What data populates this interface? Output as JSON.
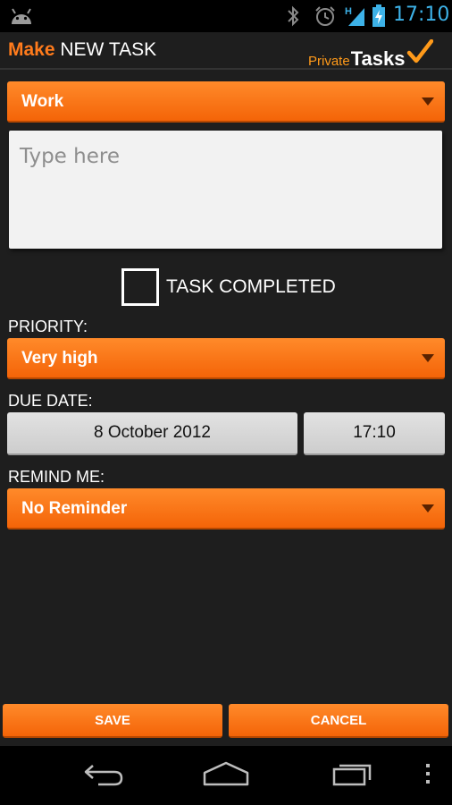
{
  "status_bar": {
    "time": "17:10",
    "network_type": "H",
    "icons": [
      "android-icon",
      "bluetooth-icon",
      "alarm-icon",
      "signal-icon",
      "battery-charging-icon"
    ]
  },
  "header": {
    "title_accent": "Make",
    "title_rest": "NEW TASK",
    "logo_small": "Private",
    "logo_big": "Tasks"
  },
  "form": {
    "category": {
      "value": "Work"
    },
    "description": {
      "value": "",
      "placeholder": "Type here"
    },
    "completed": {
      "label": "TASK COMPLETED",
      "checked": false
    },
    "priority": {
      "label": "PRIORITY:",
      "value": "Very high"
    },
    "due_date": {
      "label": "DUE DATE:",
      "date": "8 October 2012",
      "time": "17:10"
    },
    "remind": {
      "label": "REMIND ME:",
      "value": "No Reminder"
    }
  },
  "actions": {
    "save": "SAVE",
    "cancel": "CANCEL"
  },
  "colors": {
    "accent": "#ff7b1c",
    "status_blue": "#3db2e8",
    "background": "#1e1e1e"
  }
}
